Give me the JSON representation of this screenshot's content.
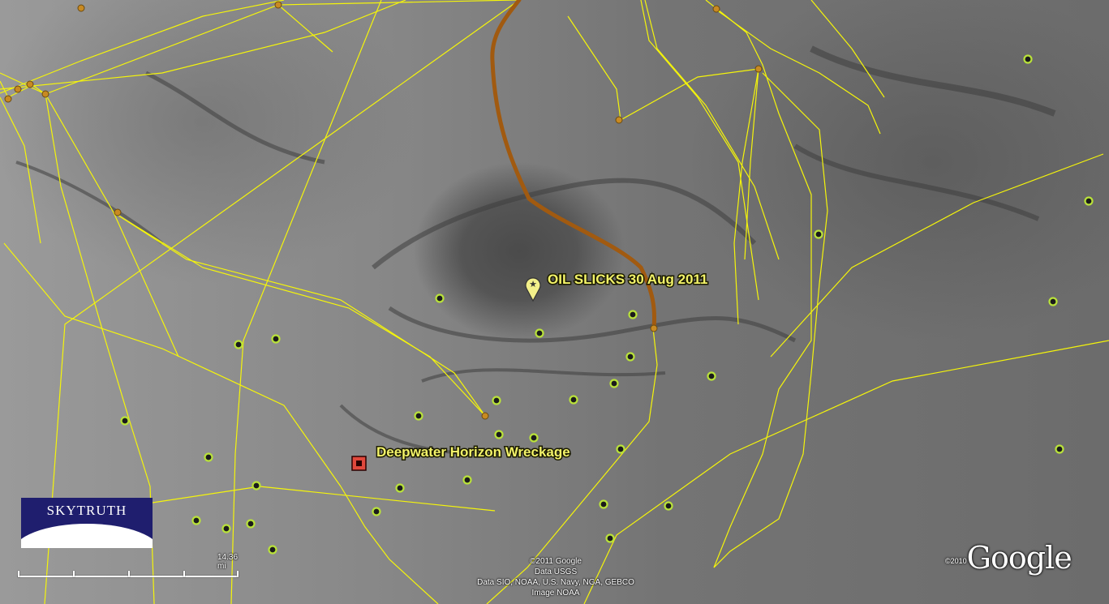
{
  "map": {
    "labels": {
      "oil_slicks": "OIL SLICKS 30 Aug 2011",
      "wreckage": "Deepwater Horizon Wreckage"
    },
    "brand": "SKYTRUTH",
    "scale": "14.36 mi",
    "credits": [
      "©2011 Google",
      "Data USGS",
      "Data SIO, NOAA, U.S. Navy, NGA, GEBCO",
      "Image NOAA"
    ],
    "logo_copyright": "©2010",
    "logo_text": "Google",
    "colors": {
      "tracks": "#f5f50a",
      "vessel_track": "#a15a10",
      "platform_marker": "#1b1b1b",
      "platform_ring": "#b9e23a",
      "waypoint": "#c88a22",
      "wreckage_marker": "#e0483c",
      "label_text": "#f3f36a"
    }
  }
}
